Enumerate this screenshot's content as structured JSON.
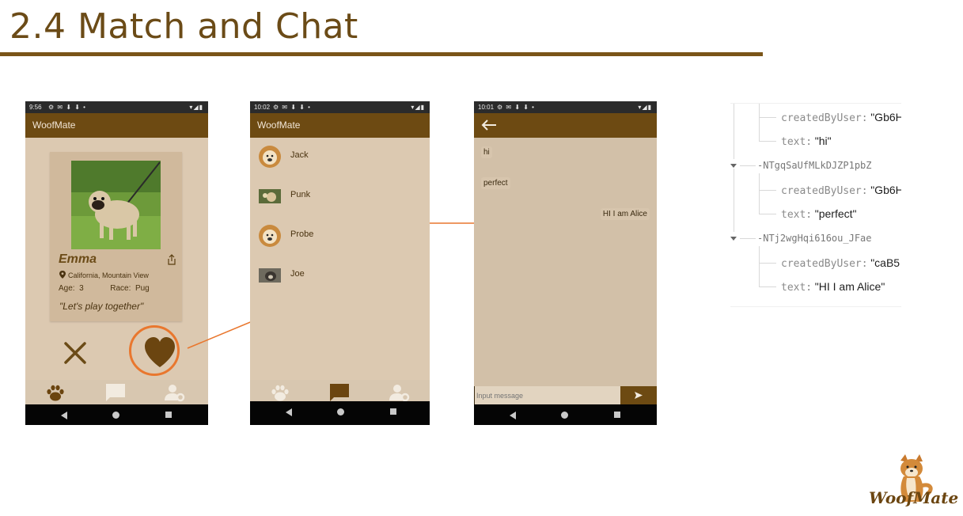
{
  "slide": {
    "title": "2.4 Match and Chat"
  },
  "app": {
    "name": "WoofMate"
  },
  "phone1": {
    "time": "9:56",
    "pet": {
      "name": "Emma",
      "location": "California, Mountain View",
      "age_label": "Age:",
      "age": "3",
      "race_label": "Race:",
      "race": "Pug",
      "quote": "\"Let's play together\""
    }
  },
  "phone2": {
    "time": "10:02",
    "matches": [
      {
        "name": "Jack"
      },
      {
        "name": "Punk"
      },
      {
        "name": "Probe"
      },
      {
        "name": "Joe"
      }
    ]
  },
  "phone3": {
    "time": "10:01",
    "messages": [
      {
        "text": "hi",
        "side": "left"
      },
      {
        "text": "perfect",
        "side": "left"
      },
      {
        "text": "HI I am Alice",
        "side": "right"
      }
    ],
    "input_placeholder": "Input message"
  },
  "db": {
    "rows": [
      {
        "key": "createdByUser:",
        "value": "\"Gb6H"
      },
      {
        "key": "text:",
        "value": "\"hi\""
      },
      {
        "id": "-NTgqSaUfMLkDJZP1pbZ"
      },
      {
        "key": "createdByUser:",
        "value": "\"Gb6H"
      },
      {
        "key": "text:",
        "value": "\"perfect\""
      },
      {
        "id": "-NTj2wgHqi616ou_JFae"
      },
      {
        "key": "createdByUser:",
        "value": "\"caB5"
      },
      {
        "key": "text:",
        "value": "\"HI I am Alice\""
      }
    ]
  },
  "logo": {
    "text": "WoofMate"
  },
  "colors": {
    "brand_brown": "#6d4a12",
    "accent_orange": "#e9772e",
    "card_bg": "#d0b99c",
    "screen_bg": "#dcc9b1"
  }
}
